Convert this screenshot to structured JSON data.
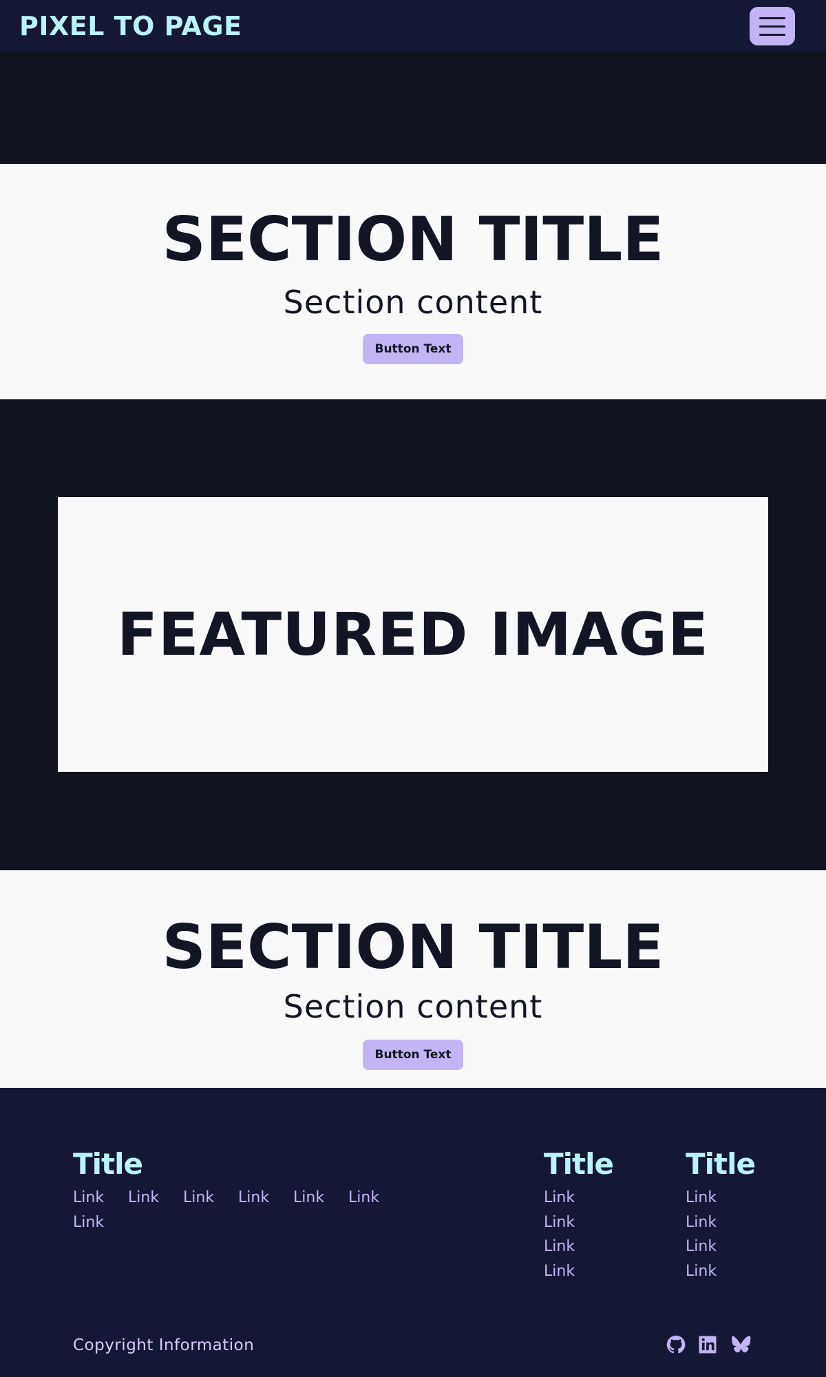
{
  "header": {
    "brand": "PIXEL TO PAGE",
    "menu_icon": "hamburger-menu-icon"
  },
  "sections": [
    {
      "title": "SECTION TITLE",
      "content": "Section content",
      "button": "Button Text"
    },
    {
      "title": "SECTION TITLE",
      "content": "Section content",
      "button": "Button Text"
    }
  ],
  "featured": {
    "label": "FEATURED IMAGE"
  },
  "footer": {
    "columns": [
      {
        "title": "Title",
        "links": [
          "Link",
          "Link",
          "Link",
          "Link",
          "Link",
          "Link",
          "Link"
        ]
      },
      {
        "title": "Title",
        "links": [
          "Link",
          "Link",
          "Link",
          "Link"
        ]
      },
      {
        "title": "Title",
        "links": [
          "Link",
          "Link",
          "Link",
          "Link"
        ]
      }
    ],
    "copyright": "Copyright Information",
    "social_icons": [
      "github-icon",
      "linkedin-icon",
      "bluesky-icon"
    ]
  },
  "colors": {
    "header_bg": "#151835",
    "dark_bg": "#11141f",
    "light_bg": "#f9f9fa",
    "accent": "#c3b4f6",
    "brand": "#b9f3fb",
    "text_dark": "#121624"
  }
}
